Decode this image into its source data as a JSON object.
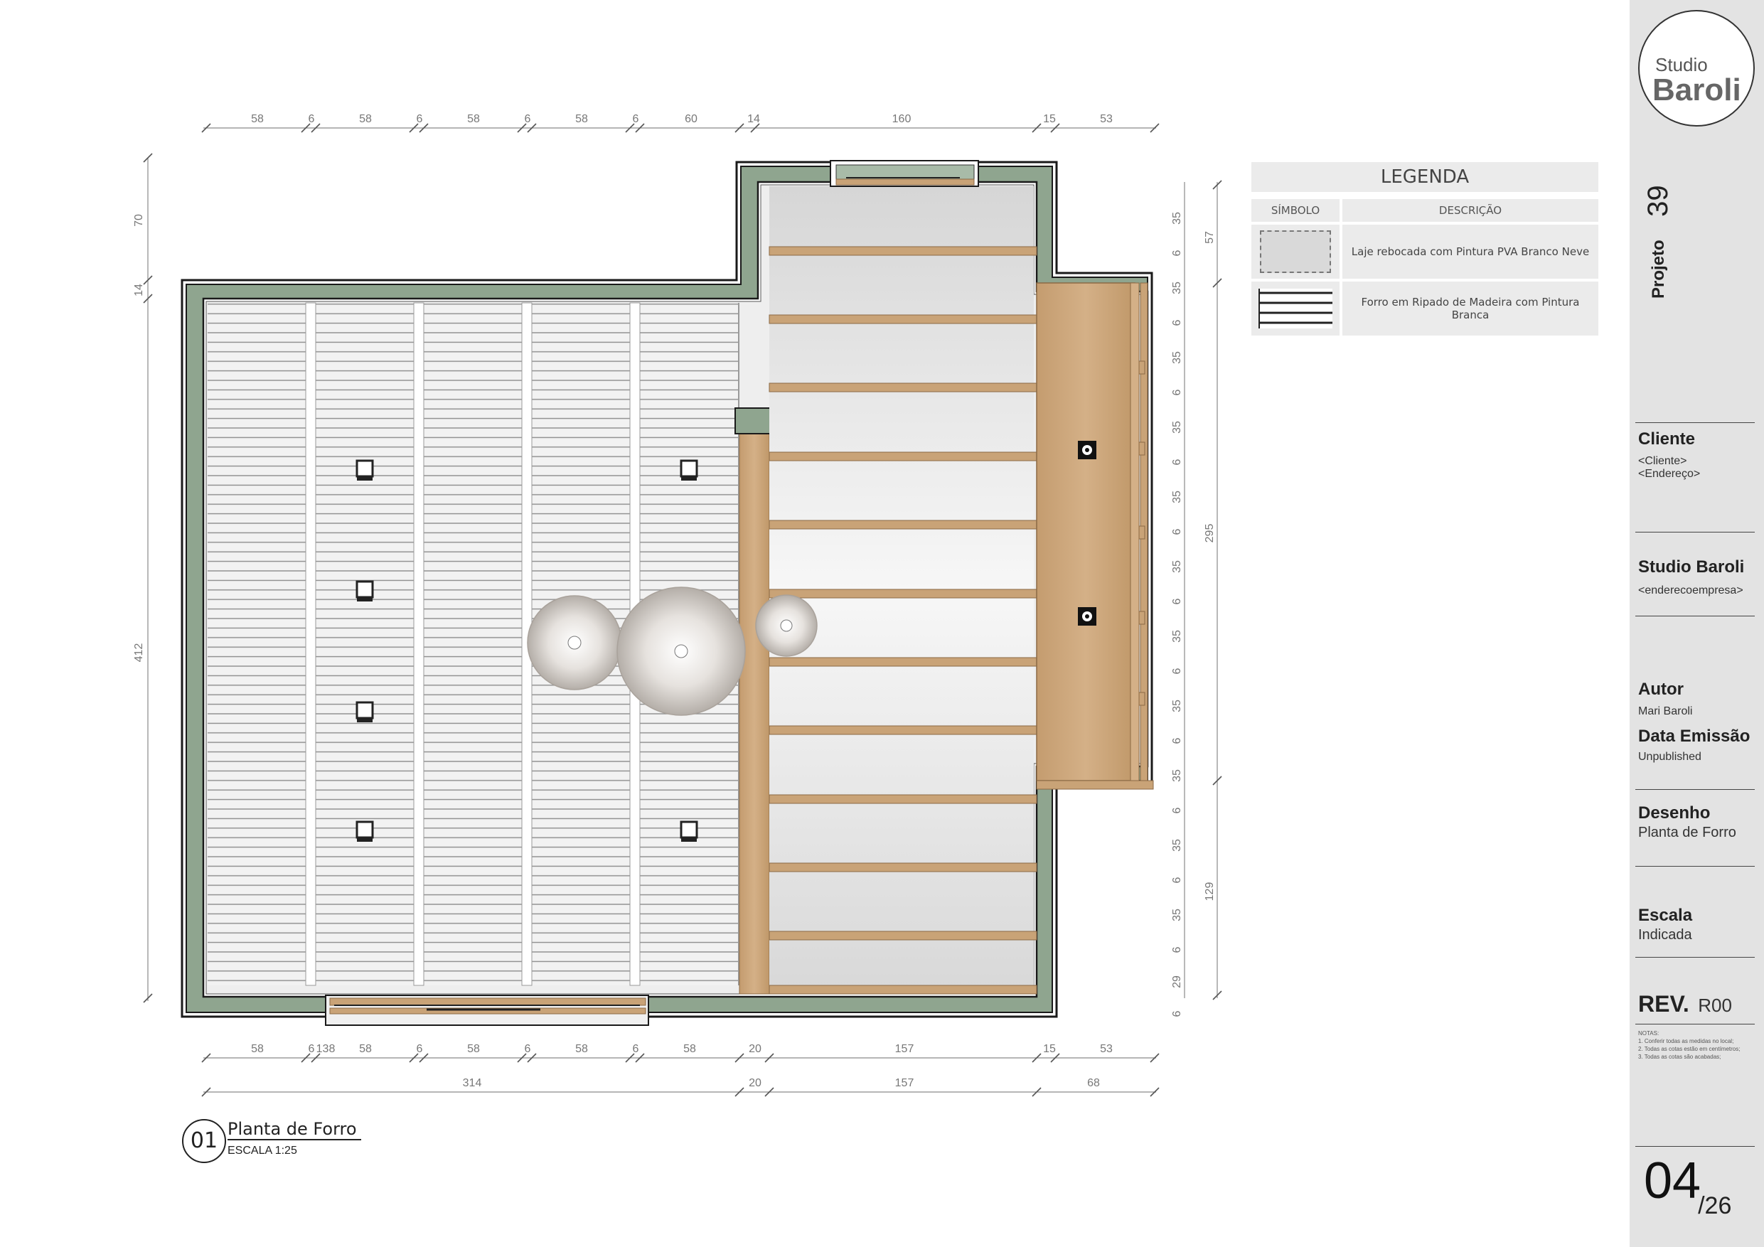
{
  "legend": {
    "title": "LEGENDA",
    "col_symbol": "SÍMBOLO",
    "col_description": "DESCRIÇÃO",
    "items": [
      {
        "symbol": "laje-rebocada",
        "description": "Laje rebocada com Pintura PVA Branco Neve"
      },
      {
        "symbol": "forro-ripado",
        "description": "Forro em Ripado de Madeira com Pintura Branca"
      }
    ]
  },
  "title_block": {
    "logo_line1": "Studio",
    "logo_line2": "Baroli",
    "projeto_label": "Projeto",
    "projeto_value": "39",
    "cliente_label": "Cliente",
    "cliente_value1": "<Cliente>",
    "cliente_value2": "<Endereço>",
    "empresa_label": "Studio Baroli",
    "empresa_value": "<enderecoempresa>",
    "autor_label": "Autor",
    "autor_value": "Mari Baroli",
    "data_label": "Data Emissão",
    "data_value": "Unpublished",
    "desenho_label": "Desenho",
    "desenho_value": "Planta de Forro",
    "escala_label": "Escala",
    "escala_value": "Indicada",
    "rev_label": "REV.",
    "rev_value": "R00",
    "notes": [
      "NOTAS:",
      "1. Conferir todas as medidas no local;",
      "2. Todas as cotas estão em centímetros;",
      "3. Todas as cotas são acabadas;"
    ],
    "sheet_number": "04",
    "sheet_total": "/26"
  },
  "view": {
    "number": "01",
    "name": "Planta de Forro",
    "scale": "ESCALA 1:25"
  },
  "dimensions": {
    "top": [
      "58",
      "6",
      "58",
      "6",
      "58",
      "6",
      "58",
      "6",
      "60",
      "14",
      "160",
      "15",
      "53"
    ],
    "bottom1": [
      "58",
      "6",
      "138",
      "58",
      "6",
      "58",
      "6",
      "58",
      "6",
      "58",
      "20",
      "157",
      "15",
      "53"
    ],
    "bottom2": [
      "314",
      "20",
      "157",
      "68"
    ],
    "left": [
      "70",
      "14",
      "412"
    ],
    "right1": [
      "35",
      "6",
      "35",
      "6",
      "35",
      "6",
      "35",
      "6",
      "35",
      "6",
      "35",
      "6",
      "35",
      "6",
      "35",
      "6",
      "35",
      "6",
      "35",
      "6",
      "35",
      "6",
      "29",
      "6"
    ],
    "right2": [
      "57",
      "295",
      "129"
    ]
  },
  "colors": {
    "wall_green": "#8fa58f",
    "wood": "#c9a377",
    "ceiling_white": "#eeeeee",
    "slat_line": "#8a8a8a"
  }
}
